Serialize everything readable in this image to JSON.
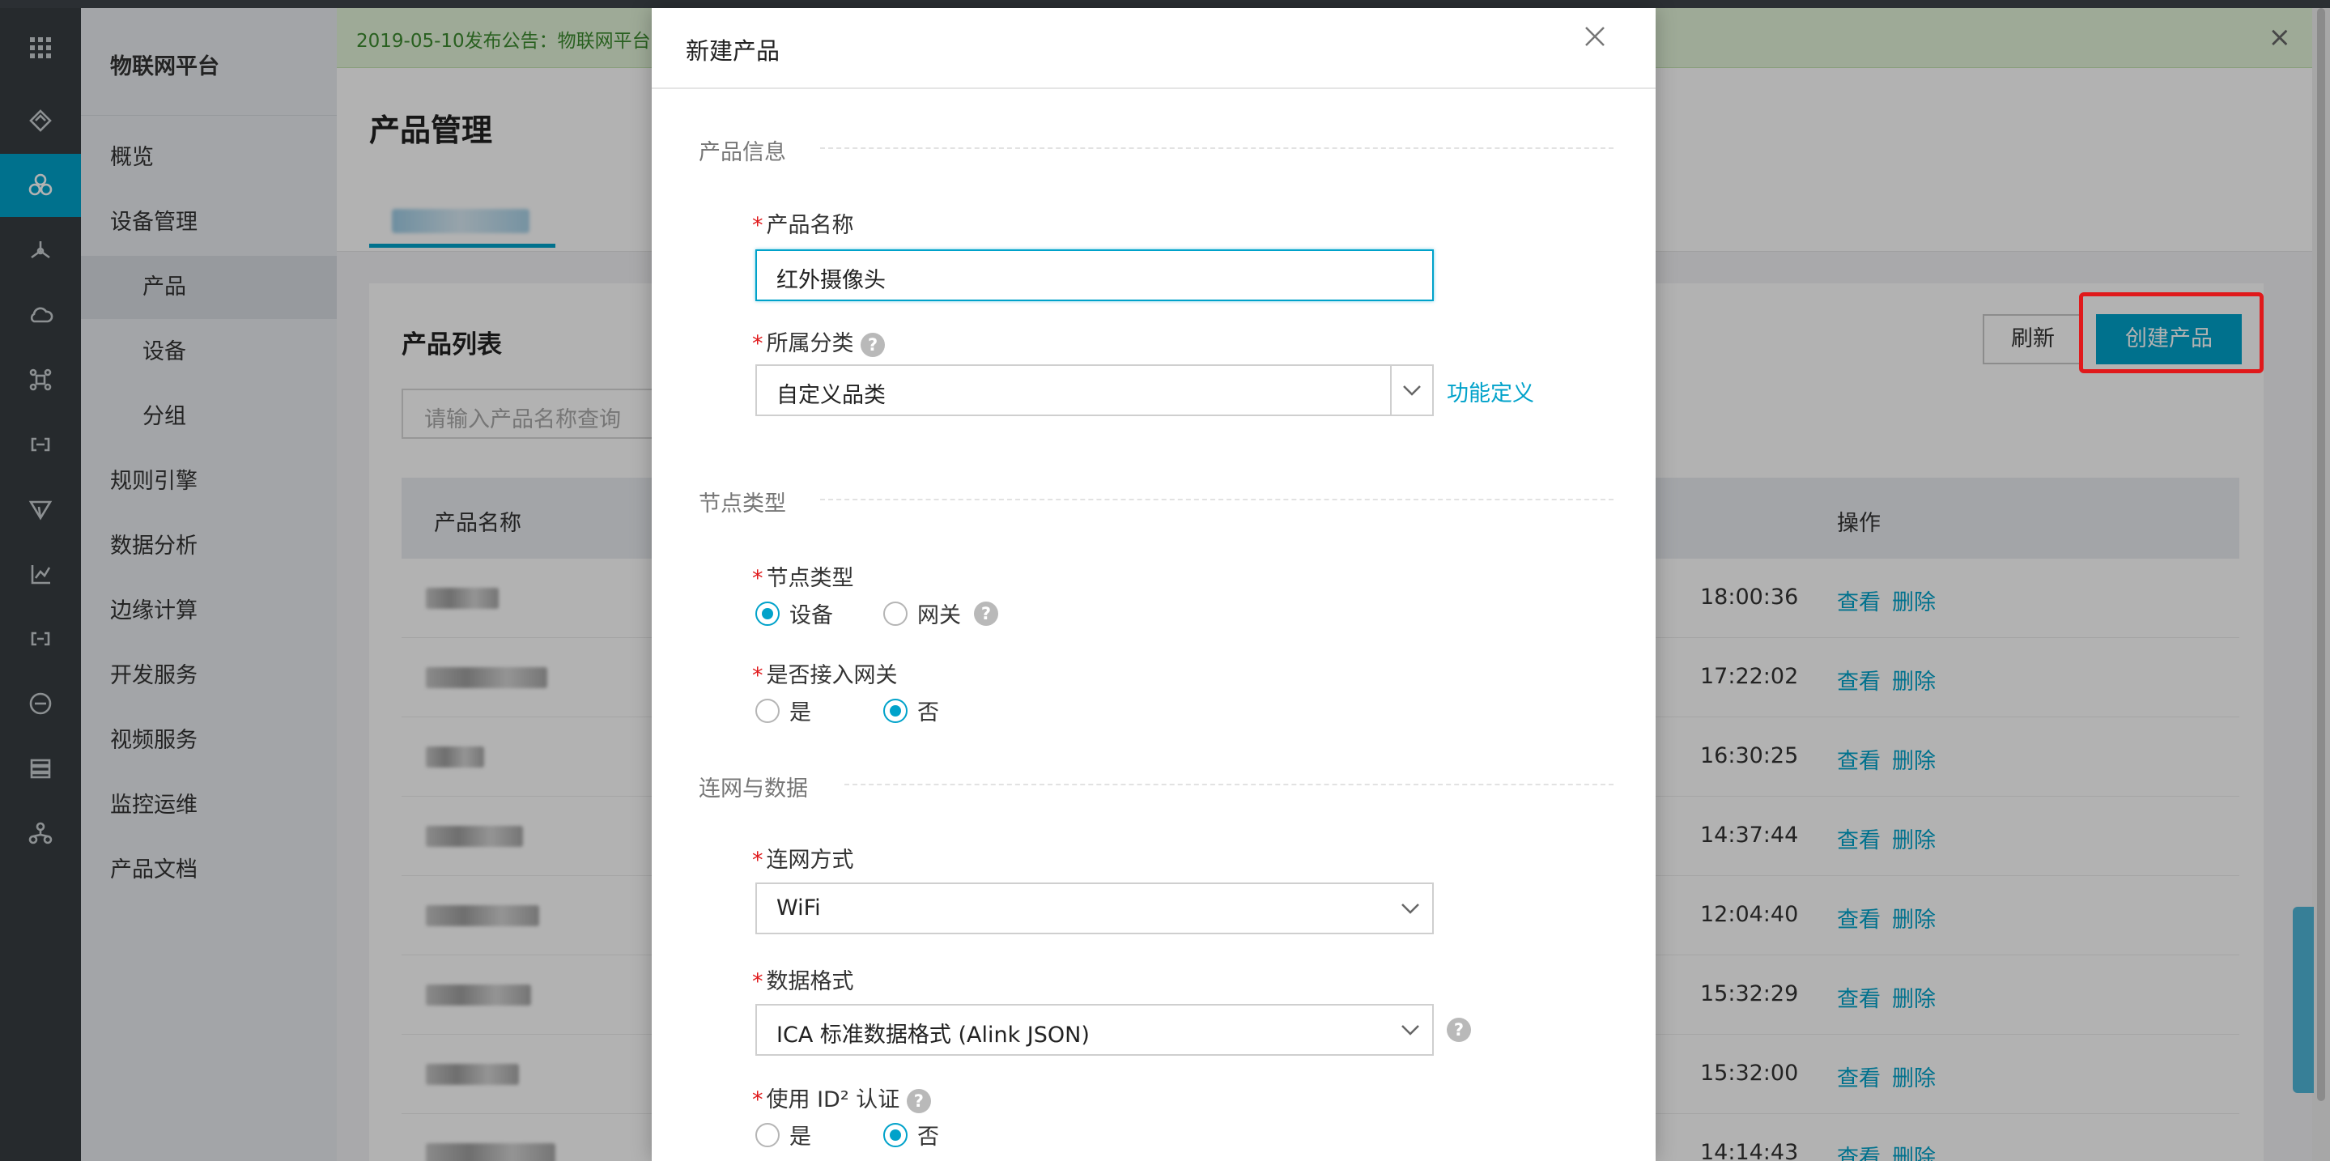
{
  "banner": {
    "text": "2019-05-10发布公告：物联网平台",
    "close": "×"
  },
  "nav": {
    "brand": "物联网平台",
    "items": [
      {
        "label": "概览"
      },
      {
        "label": "设备管理"
      },
      {
        "label": "产品"
      },
      {
        "label": "设备"
      },
      {
        "label": "分组"
      },
      {
        "label": "规则引擎"
      },
      {
        "label": "数据分析"
      },
      {
        "label": "边缘计算"
      },
      {
        "label": "开发服务"
      },
      {
        "label": "视频服务"
      },
      {
        "label": "监控运维"
      },
      {
        "label": "产品文档"
      }
    ]
  },
  "main": {
    "title": "产品管理",
    "panel_title": "产品列表",
    "search_placeholder": "请输入产品名称查询",
    "refresh": "刷新",
    "create": "创建产品",
    "columns": {
      "name": "产品名称",
      "ops": "操作"
    },
    "rows": [
      {
        "time": "18:00:36",
        "view": "查看",
        "delete": "删除"
      },
      {
        "time": "17:22:02",
        "view": "查看",
        "delete": "删除"
      },
      {
        "time": "16:30:25",
        "view": "查看",
        "delete": "删除"
      },
      {
        "time": "14:37:44",
        "view": "查看",
        "delete": "删除"
      },
      {
        "time": "12:04:40",
        "view": "查看",
        "delete": "删除"
      },
      {
        "time": "15:32:29",
        "view": "查看",
        "delete": "删除"
      },
      {
        "time": "15:32:00",
        "view": "查看",
        "delete": "删除"
      },
      {
        "time": "14:14:43",
        "view": "查看",
        "delete": "删除"
      }
    ]
  },
  "modal": {
    "title": "新建产品",
    "section_info": "产品信息",
    "name_label": "产品名称",
    "name_value": "红外摄像头",
    "category_label": "所属分类",
    "category_value": "自定义品类",
    "func_link": "功能定义",
    "section_node": "节点类型",
    "node_label": "节点类型",
    "node_opt1": "设备",
    "node_opt2": "网关",
    "gateway_label": "是否接入网关",
    "yes": "是",
    "no": "否",
    "section_net": "连网与数据",
    "net_label": "连网方式",
    "net_value": "WiFi",
    "format_label": "数据格式",
    "format_value": "ICA 标准数据格式 (Alink JSON)",
    "id2_label": "使用 ID² 认证",
    "help": "?"
  },
  "colors": {
    "accent": "#00a2ca",
    "rail": "#373d41",
    "required": "#e0191b",
    "highlight": "#e0191b"
  }
}
